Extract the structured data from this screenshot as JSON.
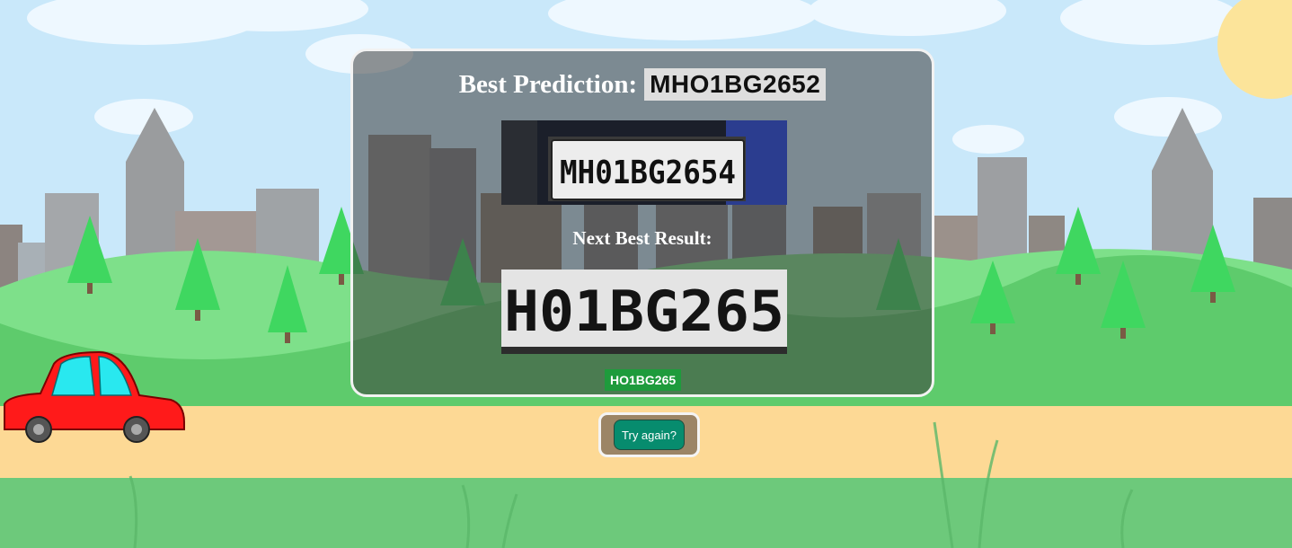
{
  "result": {
    "best_label": "Best Prediction:",
    "best_value": "MHO1BG2652",
    "first_plate_text": "MH01BG2654",
    "next_label": "Next Best Result:",
    "second_plate_text": "H01BG265",
    "next_value": "HO1BG265"
  },
  "actions": {
    "try_again_label": "Try again?"
  },
  "colors": {
    "sky": "#c9e8fa",
    "grass": "#6dc97b",
    "road": "#fdd995",
    "panel_border": "#f2f2f2",
    "next_badge": "#1e9b3c",
    "button": "#078c6e",
    "button_frame": "#9c8566"
  }
}
